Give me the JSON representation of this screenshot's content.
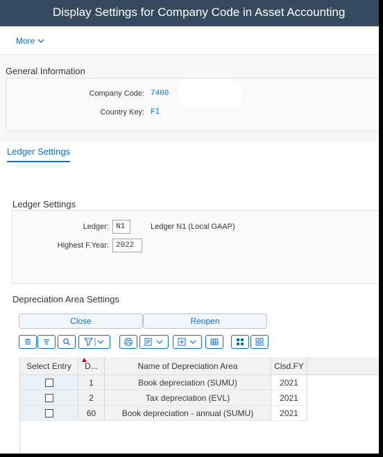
{
  "title": "Display Settings for Company Code in Asset Accounting",
  "toolbar": {
    "more_label": "More"
  },
  "general": {
    "section_title": "General Information",
    "company_code_label": "Company Code:",
    "company_code_value": "7400",
    "country_key_label": "Country Key:",
    "country_key_value": "FI"
  },
  "tabs": {
    "ledger_settings": "Ledger Settings"
  },
  "ledger": {
    "section_title": "Ledger Settings",
    "ledger_label": "Ledger:",
    "ledger_value": "N1",
    "ledger_desc": "Ledger N1 (Local GAAP)",
    "highest_fy_label": "Highest F.Year:",
    "highest_fy_value": "2022"
  },
  "depreciation": {
    "section_title": "Depreciation Area Settings",
    "close_label": "Close",
    "reopen_label": "Reopen",
    "columns": [
      "Select Entry",
      "D...",
      "Name of Depreciation Area",
      "Clsd.FY"
    ],
    "rows": [
      {
        "area": "1",
        "name": "Book depreciation (SUMU)",
        "fy": "2021"
      },
      {
        "area": "2",
        "name": "Tax depreciation (EVL)",
        "fy": "2021"
      },
      {
        "area": "60",
        "name": "Book depreciation - annual (SUMU)",
        "fy": "2021"
      }
    ]
  },
  "colors": {
    "shell": "#354a5f",
    "accent": "#0a6ed1"
  }
}
